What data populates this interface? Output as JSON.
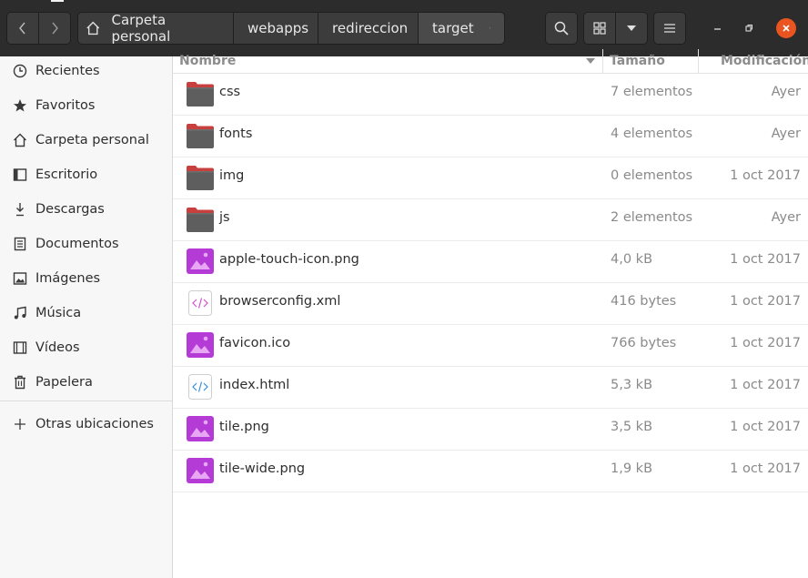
{
  "path": {
    "items": [
      "Carpeta personal",
      "webapps",
      "redireccion",
      "target"
    ]
  },
  "toolbar": {
    "back_icon": "chevron-left-icon",
    "forward_icon": "chevron-right-icon",
    "home_icon": "home-icon",
    "search_icon": "search-icon",
    "grid_icon": "grid-view-icon",
    "view_menu_icon": "caret-down-icon",
    "menu_icon": "hamburger-menu-icon"
  },
  "window": {
    "minimize_icon": "minimize-icon",
    "maximize_icon": "restore-icon",
    "close_icon": "close-icon"
  },
  "sidebar": {
    "items": [
      {
        "label": "Recientes",
        "icon": "clock-icon"
      },
      {
        "label": "Favoritos",
        "icon": "star-icon"
      },
      {
        "label": "Carpeta personal",
        "icon": "home-icon"
      },
      {
        "label": "Escritorio",
        "icon": "desktop-icon"
      },
      {
        "label": "Descargas",
        "icon": "download-icon"
      },
      {
        "label": "Documentos",
        "icon": "document-icon"
      },
      {
        "label": "Imágenes",
        "icon": "image-icon"
      },
      {
        "label": "Música",
        "icon": "music-icon"
      },
      {
        "label": "Vídeos",
        "icon": "video-icon"
      },
      {
        "label": "Papelera",
        "icon": "trash-icon"
      }
    ],
    "other": {
      "label": "Otras ubicaciones",
      "icon": "plus-icon"
    }
  },
  "columns": {
    "name": "Nombre",
    "size": "Tamaño",
    "modified": "Modificación"
  },
  "files": [
    {
      "name": "css",
      "size": "7 elementos",
      "modified": "Ayer",
      "type": "folder"
    },
    {
      "name": "fonts",
      "size": "4 elementos",
      "modified": "Ayer",
      "type": "folder"
    },
    {
      "name": "img",
      "size": "0 elementos",
      "modified": "1 oct 2017",
      "type": "folder"
    },
    {
      "name": "js",
      "size": "2 elementos",
      "modified": "Ayer",
      "type": "folder"
    },
    {
      "name": "apple-touch-icon.png",
      "size": "4,0 kB",
      "modified": "1 oct 2017",
      "type": "image"
    },
    {
      "name": "browserconfig.xml",
      "size": "416 bytes",
      "modified": "1 oct 2017",
      "type": "xml"
    },
    {
      "name": "favicon.ico",
      "size": "766 bytes",
      "modified": "1 oct 2017",
      "type": "image"
    },
    {
      "name": "index.html",
      "size": "5,3 kB",
      "modified": "1 oct 2017",
      "type": "html"
    },
    {
      "name": "tile.png",
      "size": "3,5 kB",
      "modified": "1 oct 2017",
      "type": "image"
    },
    {
      "name": "tile-wide.png",
      "size": "1,9 kB",
      "modified": "1 oct 2017",
      "type": "image"
    }
  ],
  "colors": {
    "accent": "#e95420",
    "folder_tab": "#c7403d",
    "folder_body": "#5e5e5e",
    "image_icon": "#b53bd6"
  }
}
